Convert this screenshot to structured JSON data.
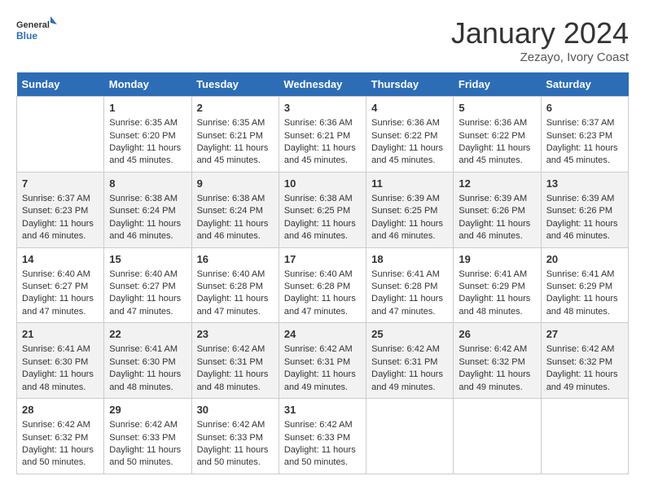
{
  "header": {
    "logo_line1": "General",
    "logo_line2": "Blue",
    "month": "January 2024",
    "location": "Zezayo, Ivory Coast"
  },
  "columns": [
    "Sunday",
    "Monday",
    "Tuesday",
    "Wednesday",
    "Thursday",
    "Friday",
    "Saturday"
  ],
  "weeks": [
    [
      {
        "day": "",
        "sunrise": "",
        "sunset": "",
        "daylight": ""
      },
      {
        "day": "1",
        "sunrise": "Sunrise: 6:35 AM",
        "sunset": "Sunset: 6:20 PM",
        "daylight": "Daylight: 11 hours and 45 minutes."
      },
      {
        "day": "2",
        "sunrise": "Sunrise: 6:35 AM",
        "sunset": "Sunset: 6:21 PM",
        "daylight": "Daylight: 11 hours and 45 minutes."
      },
      {
        "day": "3",
        "sunrise": "Sunrise: 6:36 AM",
        "sunset": "Sunset: 6:21 PM",
        "daylight": "Daylight: 11 hours and 45 minutes."
      },
      {
        "day": "4",
        "sunrise": "Sunrise: 6:36 AM",
        "sunset": "Sunset: 6:22 PM",
        "daylight": "Daylight: 11 hours and 45 minutes."
      },
      {
        "day": "5",
        "sunrise": "Sunrise: 6:36 AM",
        "sunset": "Sunset: 6:22 PM",
        "daylight": "Daylight: 11 hours and 45 minutes."
      },
      {
        "day": "6",
        "sunrise": "Sunrise: 6:37 AM",
        "sunset": "Sunset: 6:23 PM",
        "daylight": "Daylight: 11 hours and 45 minutes."
      }
    ],
    [
      {
        "day": "7",
        "sunrise": "Sunrise: 6:37 AM",
        "sunset": "Sunset: 6:23 PM",
        "daylight": "Daylight: 11 hours and 46 minutes."
      },
      {
        "day": "8",
        "sunrise": "Sunrise: 6:38 AM",
        "sunset": "Sunset: 6:24 PM",
        "daylight": "Daylight: 11 hours and 46 minutes."
      },
      {
        "day": "9",
        "sunrise": "Sunrise: 6:38 AM",
        "sunset": "Sunset: 6:24 PM",
        "daylight": "Daylight: 11 hours and 46 minutes."
      },
      {
        "day": "10",
        "sunrise": "Sunrise: 6:38 AM",
        "sunset": "Sunset: 6:25 PM",
        "daylight": "Daylight: 11 hours and 46 minutes."
      },
      {
        "day": "11",
        "sunrise": "Sunrise: 6:39 AM",
        "sunset": "Sunset: 6:25 PM",
        "daylight": "Daylight: 11 hours and 46 minutes."
      },
      {
        "day": "12",
        "sunrise": "Sunrise: 6:39 AM",
        "sunset": "Sunset: 6:26 PM",
        "daylight": "Daylight: 11 hours and 46 minutes."
      },
      {
        "day": "13",
        "sunrise": "Sunrise: 6:39 AM",
        "sunset": "Sunset: 6:26 PM",
        "daylight": "Daylight: 11 hours and 46 minutes."
      }
    ],
    [
      {
        "day": "14",
        "sunrise": "Sunrise: 6:40 AM",
        "sunset": "Sunset: 6:27 PM",
        "daylight": "Daylight: 11 hours and 47 minutes."
      },
      {
        "day": "15",
        "sunrise": "Sunrise: 6:40 AM",
        "sunset": "Sunset: 6:27 PM",
        "daylight": "Daylight: 11 hours and 47 minutes."
      },
      {
        "day": "16",
        "sunrise": "Sunrise: 6:40 AM",
        "sunset": "Sunset: 6:28 PM",
        "daylight": "Daylight: 11 hours and 47 minutes."
      },
      {
        "day": "17",
        "sunrise": "Sunrise: 6:40 AM",
        "sunset": "Sunset: 6:28 PM",
        "daylight": "Daylight: 11 hours and 47 minutes."
      },
      {
        "day": "18",
        "sunrise": "Sunrise: 6:41 AM",
        "sunset": "Sunset: 6:28 PM",
        "daylight": "Daylight: 11 hours and 47 minutes."
      },
      {
        "day": "19",
        "sunrise": "Sunrise: 6:41 AM",
        "sunset": "Sunset: 6:29 PM",
        "daylight": "Daylight: 11 hours and 48 minutes."
      },
      {
        "day": "20",
        "sunrise": "Sunrise: 6:41 AM",
        "sunset": "Sunset: 6:29 PM",
        "daylight": "Daylight: 11 hours and 48 minutes."
      }
    ],
    [
      {
        "day": "21",
        "sunrise": "Sunrise: 6:41 AM",
        "sunset": "Sunset: 6:30 PM",
        "daylight": "Daylight: 11 hours and 48 minutes."
      },
      {
        "day": "22",
        "sunrise": "Sunrise: 6:41 AM",
        "sunset": "Sunset: 6:30 PM",
        "daylight": "Daylight: 11 hours and 48 minutes."
      },
      {
        "day": "23",
        "sunrise": "Sunrise: 6:42 AM",
        "sunset": "Sunset: 6:31 PM",
        "daylight": "Daylight: 11 hours and 48 minutes."
      },
      {
        "day": "24",
        "sunrise": "Sunrise: 6:42 AM",
        "sunset": "Sunset: 6:31 PM",
        "daylight": "Daylight: 11 hours and 49 minutes."
      },
      {
        "day": "25",
        "sunrise": "Sunrise: 6:42 AM",
        "sunset": "Sunset: 6:31 PM",
        "daylight": "Daylight: 11 hours and 49 minutes."
      },
      {
        "day": "26",
        "sunrise": "Sunrise: 6:42 AM",
        "sunset": "Sunset: 6:32 PM",
        "daylight": "Daylight: 11 hours and 49 minutes."
      },
      {
        "day": "27",
        "sunrise": "Sunrise: 6:42 AM",
        "sunset": "Sunset: 6:32 PM",
        "daylight": "Daylight: 11 hours and 49 minutes."
      }
    ],
    [
      {
        "day": "28",
        "sunrise": "Sunrise: 6:42 AM",
        "sunset": "Sunset: 6:32 PM",
        "daylight": "Daylight: 11 hours and 50 minutes."
      },
      {
        "day": "29",
        "sunrise": "Sunrise: 6:42 AM",
        "sunset": "Sunset: 6:33 PM",
        "daylight": "Daylight: 11 hours and 50 minutes."
      },
      {
        "day": "30",
        "sunrise": "Sunrise: 6:42 AM",
        "sunset": "Sunset: 6:33 PM",
        "daylight": "Daylight: 11 hours and 50 minutes."
      },
      {
        "day": "31",
        "sunrise": "Sunrise: 6:42 AM",
        "sunset": "Sunset: 6:33 PM",
        "daylight": "Daylight: 11 hours and 50 minutes."
      },
      {
        "day": "",
        "sunrise": "",
        "sunset": "",
        "daylight": ""
      },
      {
        "day": "",
        "sunrise": "",
        "sunset": "",
        "daylight": ""
      },
      {
        "day": "",
        "sunrise": "",
        "sunset": "",
        "daylight": ""
      }
    ]
  ]
}
